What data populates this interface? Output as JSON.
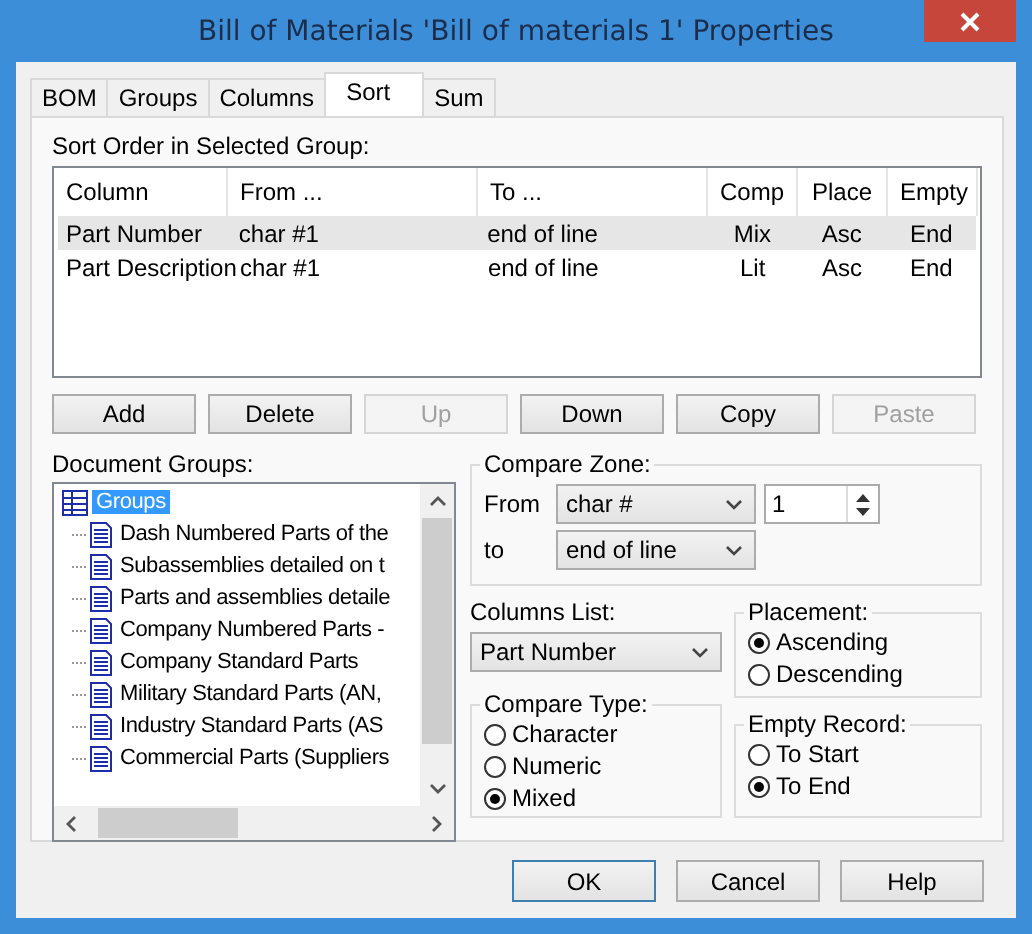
{
  "window": {
    "title": "Bill of Materials 'Bill of materials 1' Properties"
  },
  "tabs": [
    {
      "label": "BOM",
      "selected": false
    },
    {
      "label": "Groups",
      "selected": false
    },
    {
      "label": "Columns",
      "selected": false
    },
    {
      "label": "Sort",
      "selected": true
    },
    {
      "label": "Sum",
      "selected": false
    }
  ],
  "sort_order": {
    "label": "Sort Order in Selected Group:",
    "columns": [
      "Column",
      "From ...",
      "To ...",
      "Comp",
      "Place",
      "Empty"
    ],
    "rows": [
      {
        "cells": [
          "Part Number",
          "char #1",
          "end of line",
          "Mix",
          "Asc",
          "End"
        ],
        "selected": true
      },
      {
        "cells": [
          "Part Description",
          "char #1",
          "end of line",
          "Lit",
          "Asc",
          "End"
        ],
        "selected": false
      }
    ]
  },
  "list_buttons": [
    {
      "label": "Add",
      "disabled": false
    },
    {
      "label": "Delete",
      "disabled": false
    },
    {
      "label": "Up",
      "disabled": true
    },
    {
      "label": "Down",
      "disabled": false
    },
    {
      "label": "Copy",
      "disabled": false
    },
    {
      "label": "Paste",
      "disabled": true
    }
  ],
  "document_groups": {
    "label": "Document Groups:",
    "tree": {
      "label": "Groups",
      "selected": true,
      "children": [
        {
          "label": "Dash Numbered Parts of the",
          "selected": false
        },
        {
          "label": "Subassemblies detailed on t",
          "selected": false
        },
        {
          "label": "Parts and assemblies detaile",
          "selected": false
        },
        {
          "label": "Company Numbered Parts -",
          "selected": false
        },
        {
          "label": "Company Standard Parts",
          "selected": false
        },
        {
          "label": "Military Standard Parts (AN,",
          "selected": false
        },
        {
          "label": "Industry Standard Parts (AS",
          "selected": false
        },
        {
          "label": "Commercial Parts (Suppliers",
          "selected": false
        }
      ]
    }
  },
  "compare_zone": {
    "label": "Compare Zone:",
    "from_label": "From",
    "from_value": "char #",
    "from_number": "1",
    "to_label": "to",
    "to_value": "end of line"
  },
  "columns_list": {
    "label": "Columns List:",
    "value": "Part Number"
  },
  "compare_type": {
    "label": "Compare Type:",
    "options": [
      {
        "label": "Character",
        "selected": false
      },
      {
        "label": "Numeric",
        "selected": false
      },
      {
        "label": "Mixed",
        "selected": true
      }
    ]
  },
  "placement": {
    "label": "Placement:",
    "options": [
      {
        "label": "Ascending",
        "selected": true
      },
      {
        "label": "Descending",
        "selected": false
      }
    ]
  },
  "empty_record": {
    "label": "Empty Record:",
    "options": [
      {
        "label": "To Start",
        "selected": false
      },
      {
        "label": "To End",
        "selected": true
      }
    ]
  },
  "dialog_buttons": [
    {
      "label": "OK",
      "default": true
    },
    {
      "label": "Cancel",
      "default": false
    },
    {
      "label": "Help",
      "default": false
    }
  ]
}
